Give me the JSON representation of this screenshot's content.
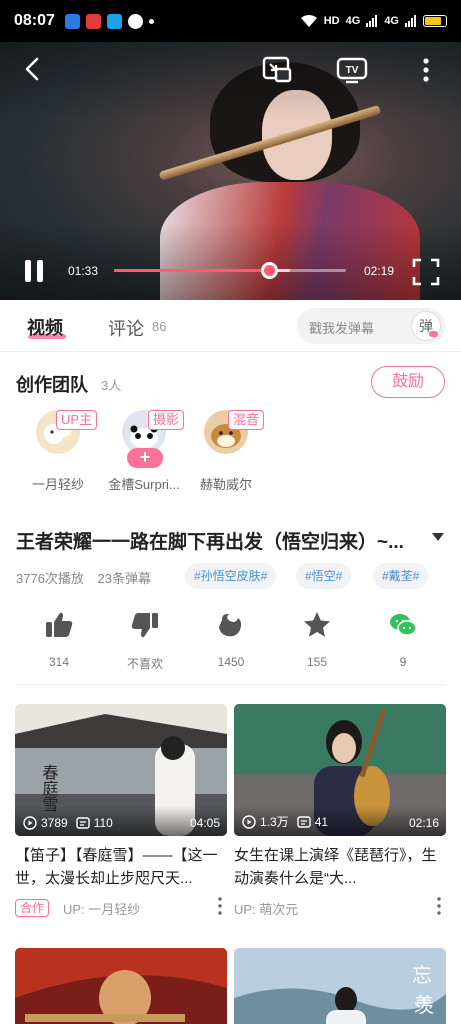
{
  "status_bar": {
    "time": "08:07",
    "network_label": "HD",
    "signal_1": "4G",
    "signal_2": "4G",
    "battery_level": 0.8
  },
  "player": {
    "current_time": "01:33",
    "duration": "02:19",
    "progress_fraction": 0.67,
    "buffered_fraction": 0.76,
    "icons": [
      "back-icon",
      "cast-icon",
      "tv-icon",
      "more-icon",
      "pause-icon",
      "fullscreen-icon"
    ]
  },
  "tabs": {
    "video_label": "视频",
    "comment_label": "评论",
    "comment_count": "86",
    "danmaku_placeholder": "戳我发弹幕",
    "danmaku_toggle": "弹"
  },
  "team": {
    "title": "创作团队",
    "count": "3人",
    "encourage_label": "鼓励",
    "members": [
      {
        "name": "一月轻纱",
        "role": "UP主",
        "avatar_color": "#f3e6c8"
      },
      {
        "name": "金槽Surpri...",
        "role": "摄影",
        "avatar_color": "#dfe6f2",
        "follow": "+"
      },
      {
        "name": "赫勒威尔",
        "role": "混音",
        "avatar_color": "#e8cfa8"
      }
    ]
  },
  "video": {
    "title": "王者荣耀一一路在脚下再出发（悟空归来）~...",
    "plays": "3776次播放",
    "danmaku": "23条弹幕",
    "tags": [
      "#孙悟空皮肤#",
      "#悟空#",
      "#戴荃#"
    ]
  },
  "actions": [
    {
      "icon": "thumbs-up-icon",
      "label": "314"
    },
    {
      "icon": "thumbs-down-icon",
      "label": "不喜欢"
    },
    {
      "icon": "coin-icon",
      "label": "1450"
    },
    {
      "icon": "star-icon",
      "label": "155"
    },
    {
      "icon": "wechat-icon",
      "label": "9"
    }
  ],
  "recommendations": [
    {
      "title": "【笛子】【春庭雪】——【这一世，太漫长却止步咫尺天...",
      "plays": "3789",
      "danmaku": "110",
      "duration": "04:05",
      "coop_badge": "合作",
      "uploader": "UP: 一月轻纱",
      "thumb_colors": [
        "#f1efe9",
        "#9aa3a5",
        "#3b3a38"
      ]
    },
    {
      "title": "女生在课上演绎《琵琶行》，生动演奏什么是“大...",
      "plays": "1.3万",
      "danmaku": "41",
      "duration": "02:16",
      "uploader": "UP: 萌次元",
      "thumb_colors": [
        "#2f6b55",
        "#7d7470",
        "#2b2a3b"
      ]
    }
  ]
}
